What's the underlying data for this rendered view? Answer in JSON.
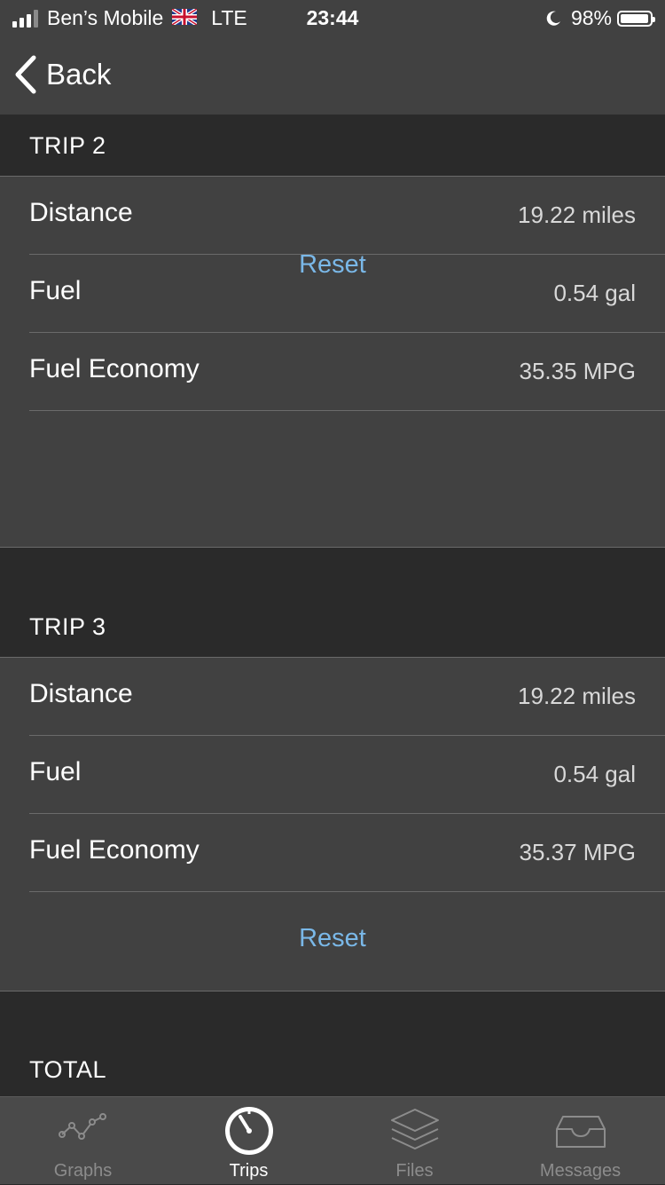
{
  "status_bar": {
    "carrier": "Ben’s Mobile",
    "network": "LTE",
    "time": "23:44",
    "battery": "98%",
    "battery_level": 0.98
  },
  "nav": {
    "back_label": "Back"
  },
  "sections": [
    {
      "title": "TRIP 2",
      "rows": [
        {
          "label": "Distance",
          "value": "19.22 miles"
        },
        {
          "label": "Fuel",
          "value": "0.54 gal"
        },
        {
          "label": "Fuel Economy",
          "value": "35.35 MPG"
        }
      ],
      "reset_label": "Reset"
    },
    {
      "title": "TRIP 3",
      "rows": [
        {
          "label": "Distance",
          "value": "19.22 miles"
        },
        {
          "label": "Fuel",
          "value": "0.54 gal"
        },
        {
          "label": "Fuel Economy",
          "value": "35.37 MPG"
        }
      ],
      "reset_label": "Reset"
    },
    {
      "title": "TOTAL"
    }
  ],
  "tabs": [
    {
      "label": "Graphs",
      "icon": "graph-icon",
      "active": false
    },
    {
      "label": "Trips",
      "icon": "speedometer-icon",
      "active": true
    },
    {
      "label": "Files",
      "icon": "layers-icon",
      "active": false
    },
    {
      "label": "Messages",
      "icon": "inbox-icon",
      "active": false
    }
  ],
  "colors": {
    "bar_background": "#414141",
    "page_background": "#2a2a2a",
    "accent_link": "#7ab8e8",
    "value_text": "#d8d8d8"
  }
}
